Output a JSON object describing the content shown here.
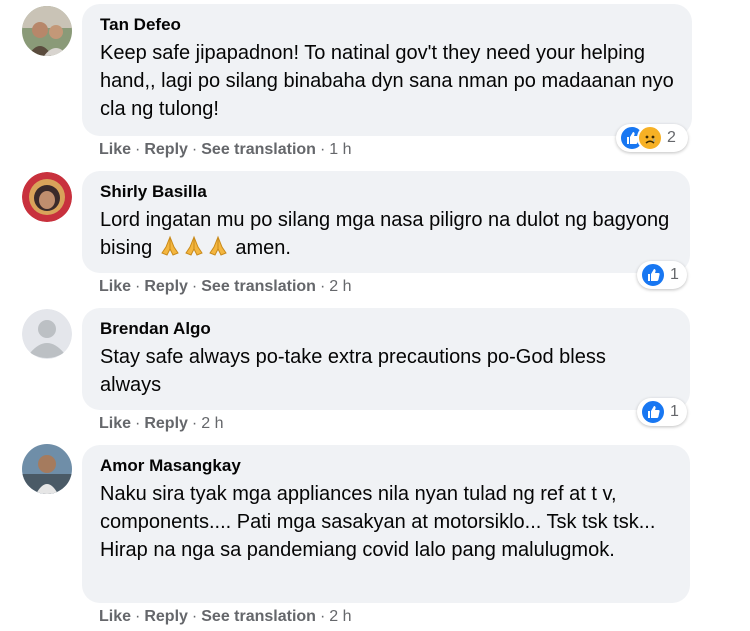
{
  "comments": [
    {
      "author": "Tan Defeo",
      "text": "Keep safe jipapadnon! To natinal gov't they need your helping hand,, lagi po silang binabaha dyn sana nman po madaanan nyo cla ng tulong!",
      "actions": {
        "like": "Like",
        "reply": "Reply",
        "translate": "See translation",
        "time": "1 h"
      },
      "reactions": {
        "icons": [
          "like-icon",
          "sad-icon"
        ],
        "count": "2"
      }
    },
    {
      "author": "Shirly Basilla",
      "text_before": "Lord ingatan mu po silang mga nasa piligro na dulot ng bagyong bising ",
      "text_after": " amen.",
      "emoji": [
        "folded-hands-icon",
        "folded-hands-icon",
        "folded-hands-icon"
      ],
      "actions": {
        "like": "Like",
        "reply": "Reply",
        "translate": "See translation",
        "time": "2 h"
      },
      "reactions": {
        "icons": [
          "like-icon"
        ],
        "count": "1"
      }
    },
    {
      "author": "Brendan Algo",
      "text": "Stay safe always po-take extra precautions po-God bless always",
      "actions": {
        "like": "Like",
        "reply": "Reply",
        "time": "2 h"
      },
      "reactions": {
        "icons": [
          "like-icon"
        ],
        "count": "1"
      }
    },
    {
      "author": "Amor Masangkay",
      "text": "Naku sira tyak mga appliances nila nyan tulad ng ref at t v, components.... Pati mga sasakyan at motorsiklo... Tsk tsk tsk... Hirap na nga sa pandemiang covid lalo pang malulugmok.",
      "actions": {
        "like": "Like",
        "reply": "Reply",
        "translate": "See translation",
        "time": "2 h"
      }
    }
  ],
  "colors": {
    "bubble": "#f0f2f5",
    "muted": "#65676b",
    "like": "#1877f2",
    "sad": "#f7b125"
  }
}
